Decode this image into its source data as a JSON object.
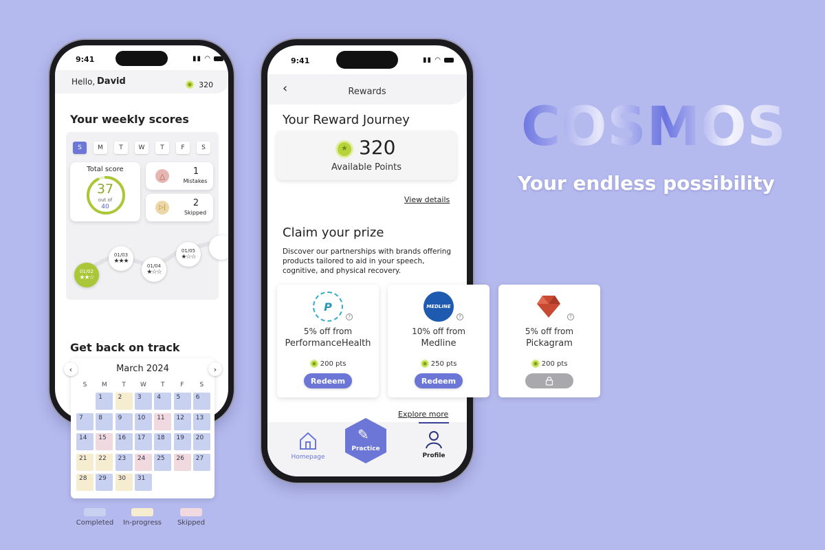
{
  "branding": {
    "title": "COSMOS",
    "tagline": "Your endless possibility",
    "accent_color": "#6b76d6"
  },
  "phone1": {
    "status_time": "9:41",
    "greeting_prefix": "Hello,",
    "user_name": "David",
    "points": "320",
    "weekly_title": "Your weekly scores",
    "days": [
      "S",
      "M",
      "T",
      "W",
      "T",
      "F",
      "S"
    ],
    "active_day_index": 0,
    "total_score_label": "Total score",
    "score_value": "37",
    "score_out_of_label": "out of",
    "score_max": "40",
    "mistakes": {
      "count": "1",
      "label": "Mistakes",
      "icon": "warning-icon"
    },
    "skipped": {
      "count": "2",
      "label": "Skipped",
      "icon": "skip-icon"
    },
    "progress_nodes": [
      {
        "date": "01/02",
        "stars": 2,
        "current": true
      },
      {
        "date": "01/03",
        "stars": 3,
        "current": false
      },
      {
        "date": "01/04",
        "stars": 1,
        "current": false
      },
      {
        "date": "01/05",
        "stars": 1,
        "current": false
      }
    ],
    "back_on_track_title": "Get back on track",
    "calendar": {
      "month_label": "March 2024",
      "weekday_headers": [
        "S",
        "M",
        "T",
        "W",
        "T",
        "F",
        "S"
      ],
      "days": [
        {
          "d": "1",
          "s": "completed"
        },
        {
          "d": "2",
          "s": "inprogress"
        },
        {
          "d": "3",
          "s": "completed"
        },
        {
          "d": "4",
          "s": "completed"
        },
        {
          "d": "5",
          "s": "completed"
        },
        {
          "d": "6",
          "s": "completed"
        },
        {
          "d": "7",
          "s": "completed"
        },
        {
          "d": "8",
          "s": "completed"
        },
        {
          "d": "9",
          "s": "completed"
        },
        {
          "d": "10",
          "s": "completed"
        },
        {
          "d": "11",
          "s": "skipped"
        },
        {
          "d": "12",
          "s": "completed"
        },
        {
          "d": "13",
          "s": "completed"
        },
        {
          "d": "14",
          "s": "completed"
        },
        {
          "d": "15",
          "s": "skipped"
        },
        {
          "d": "16",
          "s": "completed"
        },
        {
          "d": "17",
          "s": "completed"
        },
        {
          "d": "18",
          "s": "completed"
        },
        {
          "d": "19",
          "s": "completed"
        },
        {
          "d": "20",
          "s": "completed"
        },
        {
          "d": "21",
          "s": "inprogress"
        },
        {
          "d": "22",
          "s": "inprogress"
        },
        {
          "d": "23",
          "s": "completed"
        },
        {
          "d": "24",
          "s": "skipped"
        },
        {
          "d": "25",
          "s": "completed"
        },
        {
          "d": "26",
          "s": "skipped"
        },
        {
          "d": "27",
          "s": "completed"
        },
        {
          "d": "28",
          "s": "inprogress"
        },
        {
          "d": "29",
          "s": "completed"
        },
        {
          "d": "30",
          "s": "inprogress"
        },
        {
          "d": "31",
          "s": "completed"
        }
      ],
      "first_weekday_index": 1
    },
    "legend": [
      {
        "label": "Completed",
        "color": "#c9d1f1"
      },
      {
        "label": "In-progress",
        "color": "#f6ecd0"
      },
      {
        "label": "Skipped",
        "color": "#f1d9e0"
      }
    ]
  },
  "phone2": {
    "status_time": "9:41",
    "header_title": "Rewards",
    "journey_title": "Your Reward Journey",
    "points_value": "320",
    "points_label": "Available Points",
    "view_details": "View details",
    "claim_title": "Claim your prize",
    "claim_description": "Discover our partnerships with brands offering products tailored to aid in your speech, cognitive, and physical recovery.",
    "brands": [
      {
        "logo": "performance-health-logo",
        "logo_text": "PERFORMANCE HEALTH",
        "discount": "5% off from",
        "name": "PerformanceHealth",
        "points": "200 pts",
        "action": "Redeem",
        "locked": false
      },
      {
        "logo": "medline-logo",
        "logo_text": "MEDLINE",
        "discount": "10% off from",
        "name": "Medline",
        "points": "250 pts",
        "action": "Redeem",
        "locked": false
      },
      {
        "logo": "pickagram-logo",
        "logo_text": "",
        "discount": "5% off from",
        "name": "Pickagram",
        "points": "200 pts",
        "action": "",
        "locked": true
      }
    ],
    "explore_more": "Explore more",
    "nav": {
      "home": "Homepage",
      "practice": "Practice",
      "profile": "Profile"
    }
  }
}
